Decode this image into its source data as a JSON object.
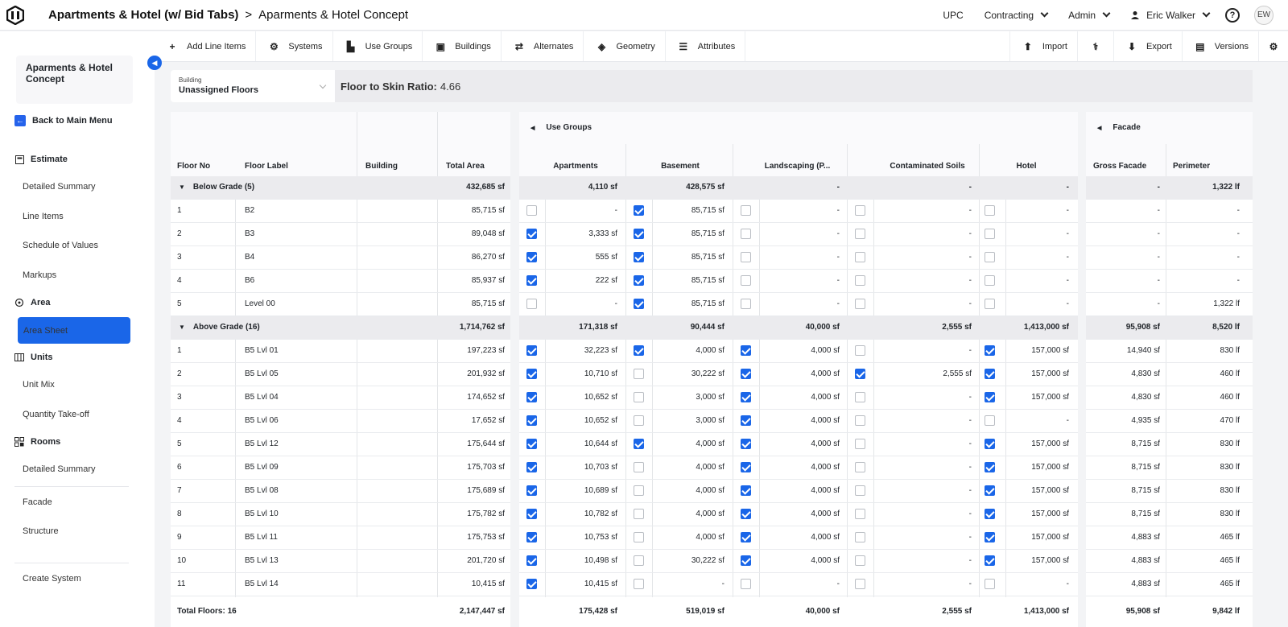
{
  "header": {
    "project": "Apartments & Hotel (w/ Bid Tabs)",
    "separator": ">",
    "estimate": "Aparments & Hotel Concept",
    "upc": "UPC",
    "contracting": "Contracting",
    "admin": "Admin",
    "user": "Eric Walker",
    "initials": "EW",
    "help": "?"
  },
  "sidebar": {
    "card_title": "Aparments & Hotel Concept",
    "back": "Back to Main Menu",
    "estimate": "Estimate",
    "detailed_summary": "Detailed Summary",
    "line_items": "Line Items",
    "schedule_of_values": "Schedule of Values",
    "markups": "Markups",
    "area": "Area",
    "area_sheet": "Area Sheet",
    "units": "Units",
    "unit_mix": "Unit Mix",
    "quantity_takeoff": "Quantity Take-off",
    "rooms": "Rooms",
    "rooms_detailed_summary": "Detailed Summary",
    "facade": "Facade",
    "structure": "Structure",
    "create_system": "Create System"
  },
  "toolbar": {
    "add_line_items": "Add Line Items",
    "systems": "Systems",
    "use_groups": "Use Groups",
    "buildings": "Buildings",
    "alternates": "Alternates",
    "geometry": "Geometry",
    "attributes": "Attributes",
    "import": "Import",
    "export": "Export",
    "versions": "Versions"
  },
  "building_select": {
    "label": "Building",
    "value": "Unassigned Floors"
  },
  "ratio": {
    "label": "Floor to Skin Ratio:",
    "value": "4.66"
  },
  "left_columns": {
    "floor_no": "Floor No",
    "floor_label": "Floor Label",
    "building": "Building",
    "total_area": "Total Area"
  },
  "use_groups": {
    "title": "Use Groups",
    "columns": [
      "Apartments",
      "Basement",
      "Landscaping (P...",
      "Contaminated Soils",
      "Hotel"
    ]
  },
  "facade": {
    "title": "Facade",
    "columns": [
      "Gross Facade",
      "Perimeter"
    ]
  },
  "sections": [
    {
      "title": "Below Grade (5)",
      "total_area": "432,685 sf",
      "use_totals": [
        "4,110 sf",
        "428,575 sf",
        "-",
        "-",
        "-"
      ],
      "facade_totals": [
        "-",
        "1,322 lf"
      ],
      "rows": [
        {
          "no": "1",
          "label": "B2",
          "total": "85,715 sf",
          "checks": [
            false,
            true,
            false,
            false,
            false
          ],
          "uses": [
            "-",
            "85,715 sf",
            "-",
            "-",
            "-"
          ],
          "facade": [
            "-",
            "-"
          ]
        },
        {
          "no": "2",
          "label": "B3",
          "total": "89,048 sf",
          "checks": [
            true,
            true,
            false,
            false,
            false
          ],
          "uses": [
            "3,333 sf",
            "85,715 sf",
            "-",
            "-",
            "-"
          ],
          "facade": [
            "-",
            "-"
          ]
        },
        {
          "no": "3",
          "label": "B4",
          "total": "86,270 sf",
          "checks": [
            true,
            true,
            false,
            false,
            false
          ],
          "uses": [
            "555 sf",
            "85,715 sf",
            "-",
            "-",
            "-"
          ],
          "facade": [
            "-",
            "-"
          ]
        },
        {
          "no": "4",
          "label": "B6",
          "total": "85,937 sf",
          "checks": [
            true,
            true,
            false,
            false,
            false
          ],
          "uses": [
            "222 sf",
            "85,715 sf",
            "-",
            "-",
            "-"
          ],
          "facade": [
            "-",
            "-"
          ]
        },
        {
          "no": "5",
          "label": "Level 00",
          "total": "85,715 sf",
          "checks": [
            false,
            true,
            false,
            false,
            false
          ],
          "uses": [
            "-",
            "85,715 sf",
            "-",
            "-",
            "-"
          ],
          "facade": [
            "-",
            "1,322 lf"
          ]
        }
      ]
    },
    {
      "title": "Above Grade (16)",
      "total_area": "1,714,762 sf",
      "use_totals": [
        "171,318 sf",
        "90,444 sf",
        "40,000 sf",
        "2,555 sf",
        "1,413,000 sf"
      ],
      "facade_totals": [
        "95,908 sf",
        "8,520 lf"
      ],
      "rows": [
        {
          "no": "1",
          "label": "B5 Lvl 01",
          "total": "197,223 sf",
          "checks": [
            true,
            true,
            true,
            false,
            true
          ],
          "uses": [
            "32,223 sf",
            "4,000 sf",
            "4,000 sf",
            "-",
            "157,000 sf"
          ],
          "facade": [
            "14,940 sf",
            "830 lf"
          ]
        },
        {
          "no": "2",
          "label": "B5 Lvl 05",
          "total": "201,932 sf",
          "checks": [
            true,
            false,
            true,
            true,
            true
          ],
          "uses": [
            "10,710 sf",
            "30,222 sf",
            "4,000 sf",
            "2,555 sf",
            "157,000 sf"
          ],
          "facade": [
            "4,830 sf",
            "460 lf"
          ]
        },
        {
          "no": "3",
          "label": "B5 Lvl 04",
          "total": "174,652 sf",
          "checks": [
            true,
            false,
            true,
            false,
            true
          ],
          "uses": [
            "10,652 sf",
            "3,000 sf",
            "4,000 sf",
            "-",
            "157,000 sf"
          ],
          "facade": [
            "4,830 sf",
            "460 lf"
          ]
        },
        {
          "no": "4",
          "label": "B5 Lvl 06",
          "total": "17,652 sf",
          "checks": [
            true,
            false,
            true,
            false,
            false
          ],
          "uses": [
            "10,652 sf",
            "3,000 sf",
            "4,000 sf",
            "-",
            "-"
          ],
          "facade": [
            "4,935 sf",
            "470 lf"
          ]
        },
        {
          "no": "5",
          "label": "B5 Lvl 12",
          "total": "175,644 sf",
          "checks": [
            true,
            true,
            true,
            false,
            true
          ],
          "uses": [
            "10,644 sf",
            "4,000 sf",
            "4,000 sf",
            "-",
            "157,000 sf"
          ],
          "facade": [
            "8,715 sf",
            "830 lf"
          ]
        },
        {
          "no": "6",
          "label": "B5 Lvl 09",
          "total": "175,703 sf",
          "checks": [
            true,
            false,
            true,
            false,
            true
          ],
          "uses": [
            "10,703 sf",
            "4,000 sf",
            "4,000 sf",
            "-",
            "157,000 sf"
          ],
          "facade": [
            "8,715 sf",
            "830 lf"
          ]
        },
        {
          "no": "7",
          "label": "B5 Lvl 08",
          "total": "175,689 sf",
          "checks": [
            true,
            false,
            true,
            false,
            true
          ],
          "uses": [
            "10,689 sf",
            "4,000 sf",
            "4,000 sf",
            "-",
            "157,000 sf"
          ],
          "facade": [
            "8,715 sf",
            "830 lf"
          ]
        },
        {
          "no": "8",
          "label": "B5 Lvl 10",
          "total": "175,782 sf",
          "checks": [
            true,
            false,
            true,
            false,
            true
          ],
          "uses": [
            "10,782 sf",
            "4,000 sf",
            "4,000 sf",
            "-",
            "157,000 sf"
          ],
          "facade": [
            "8,715 sf",
            "830 lf"
          ]
        },
        {
          "no": "9",
          "label": "B5 Lvl 11",
          "total": "175,753 sf",
          "checks": [
            true,
            false,
            true,
            false,
            true
          ],
          "uses": [
            "10,753 sf",
            "4,000 sf",
            "4,000 sf",
            "-",
            "157,000 sf"
          ],
          "facade": [
            "4,883 sf",
            "465 lf"
          ]
        },
        {
          "no": "10",
          "label": "B5 Lvl 13",
          "total": "201,720 sf",
          "checks": [
            true,
            false,
            true,
            false,
            true
          ],
          "uses": [
            "10,498 sf",
            "30,222 sf",
            "4,000 sf",
            "-",
            "157,000 sf"
          ],
          "facade": [
            "4,883 sf",
            "465 lf"
          ]
        },
        {
          "no": "11",
          "label": "B5 Lvl 14",
          "total": "10,415 sf",
          "checks": [
            true,
            false,
            false,
            false,
            false
          ],
          "uses": [
            "10,415 sf",
            "-",
            "-",
            "-",
            "-"
          ],
          "facade": [
            "4,883 sf",
            "465 lf"
          ]
        }
      ]
    }
  ],
  "footer": {
    "total_floors": "Total Floors: 16",
    "total_area": "2,147,447 sf",
    "uses": [
      "175,428 sf",
      "519,019 sf",
      "40,000 sf",
      "2,555 sf",
      "1,413,000 sf"
    ],
    "facade": [
      "95,908 sf",
      "9,842 lf"
    ]
  },
  "colors": {
    "accent": "#1a66e8",
    "section_bg": "#ebebee",
    "page_bg": "#f3f4f6"
  }
}
